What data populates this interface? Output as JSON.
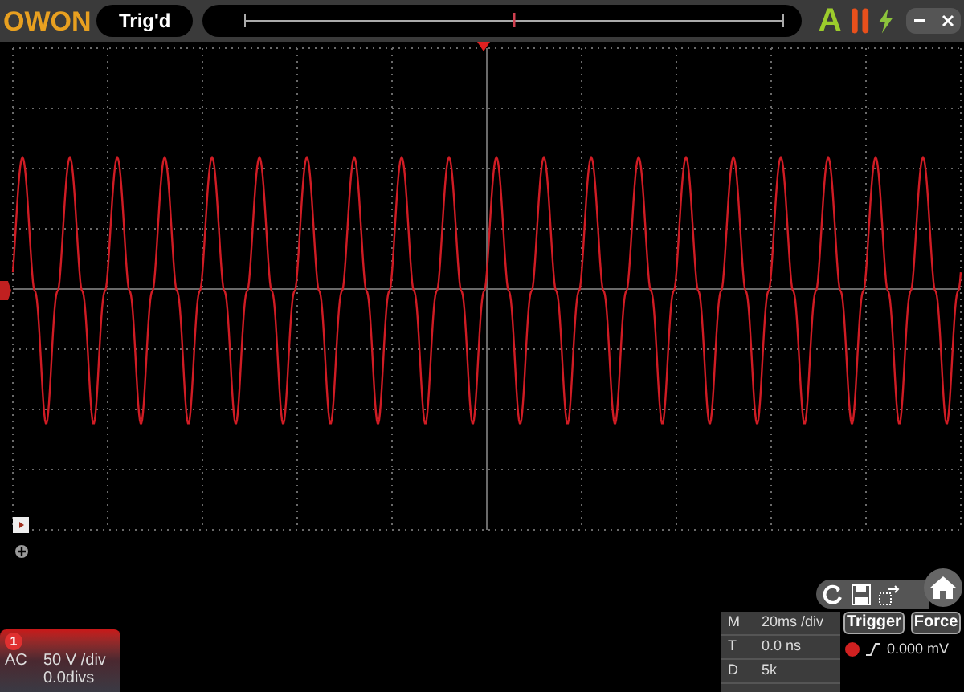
{
  "top_bar": {
    "logo": "OWON",
    "status": "Trig'd",
    "mode": "A"
  },
  "channel": {
    "number": "1",
    "coupling": "AC",
    "scale": "50 V /div",
    "offset": "0.0divs"
  },
  "timebase": [
    {
      "label": "M",
      "value": "20ms /div"
    },
    {
      "label": "T",
      "value": "0.0 ns"
    },
    {
      "label": "D",
      "value": "5k"
    }
  ],
  "trigger": {
    "buttons": [
      "Trigger",
      "Force"
    ],
    "level": "0.000 mV"
  }
}
